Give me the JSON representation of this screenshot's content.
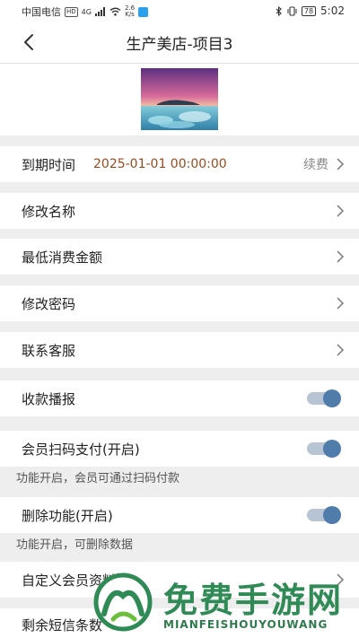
{
  "status_bar": {
    "carrier": "中国电信",
    "hd": "HD",
    "network": "4G",
    "speed": "2.6",
    "speed_unit": "K/s",
    "battery": "78",
    "time": "5:02"
  },
  "header": {
    "title": "生产美店-项目3",
    "back_icon": "chevron-left-icon"
  },
  "logo": {
    "icon": "store-logo-image"
  },
  "rows": [
    {
      "label": "到期时间",
      "value": "2025-01-01 00:00:00",
      "action": "续费",
      "type": "link"
    },
    {
      "label": "修改名称",
      "type": "link"
    },
    {
      "label": "最低消费金额",
      "type": "link"
    },
    {
      "label": "修改密码",
      "type": "link"
    },
    {
      "label": "联系客服",
      "type": "link"
    },
    {
      "label": "收款播报",
      "type": "toggle",
      "on": true
    },
    {
      "label": "会员扫码支付(开启)",
      "type": "toggle",
      "on": true,
      "hint": "功能开启，会员可通过扫码付款"
    },
    {
      "label": "删除功能(开启)",
      "type": "toggle",
      "on": true,
      "hint": "功能开启，可删除数据"
    },
    {
      "label": "自定义会员资料",
      "type": "link"
    },
    {
      "label": "剩余短信条数",
      "type": "link"
    }
  ],
  "watermark": {
    "cn": "免费手游网",
    "en": "MIANFEISHOUYOUWANG"
  },
  "colors": {
    "accent": "#4f7cab",
    "toggle_track": "#b6c4d4",
    "date_text": "#9a4a1c",
    "watermark": "#2f8a55"
  }
}
